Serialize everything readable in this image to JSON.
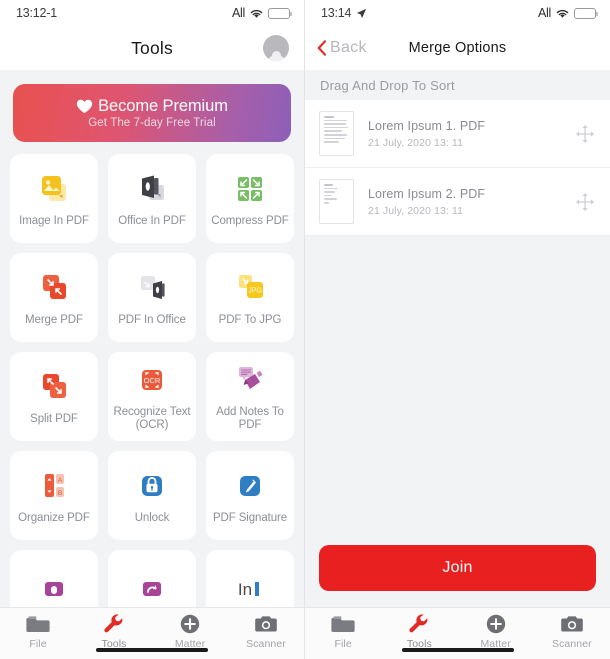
{
  "left": {
    "status": {
      "time": "13:12-1",
      "carrier": "All"
    },
    "nav": {
      "title": "Tools",
      "avatar_icon": "user-avatar-icon"
    },
    "premium": {
      "title": "Become Premium",
      "subtitle": "Get The 7-day Free Trial",
      "icon": "heart-icon"
    },
    "tools": [
      {
        "label": "Image In PDF",
        "icon": "image-to-pdf-icon",
        "color": "#f7c325"
      },
      {
        "label": "Office In PDF",
        "icon": "office-to-pdf-icon",
        "color": "#3f4045"
      },
      {
        "label": "Compress PDF",
        "icon": "compress-pdf-icon",
        "color": "#68b45a"
      },
      {
        "label": "Merge PDF",
        "icon": "merge-pdf-icon",
        "color": "#ec5b3b"
      },
      {
        "label": "PDF In Office",
        "icon": "pdf-to-office-icon",
        "color": "#3f4045"
      },
      {
        "label": "PDF To JPG",
        "icon": "pdf-to-jpg-icon",
        "color": "#f5c82a"
      },
      {
        "label": "Split PDF",
        "icon": "split-pdf-icon",
        "color": "#ec5b3b"
      },
      {
        "label": "Recognize Text (OCR)",
        "icon": "ocr-icon",
        "color": "#ed5a3a"
      },
      {
        "label": "Add Notes To PDF",
        "icon": "add-notes-icon",
        "color": "#a84f9c"
      },
      {
        "label": "Organize PDF",
        "icon": "organize-pdf-icon",
        "color": "#ec5b3b"
      },
      {
        "label": "Unlock",
        "icon": "unlock-icon",
        "color": "#2f7ec4"
      },
      {
        "label": "PDF Signature",
        "icon": "pdf-signature-icon",
        "color": "#2f7ec4"
      },
      {
        "label": "",
        "icon": "protect-pdf-icon",
        "color": "#a8439a"
      },
      {
        "label": "",
        "icon": "rotate-pdf-icon",
        "color": "#a8439a"
      },
      {
        "label": "",
        "icon": "insert-text-icon",
        "color": "#2f7ec4"
      }
    ],
    "tabs": [
      {
        "label": "File",
        "icon": "folder-icon",
        "active": false
      },
      {
        "label": "Tools",
        "icon": "wrench-icon",
        "active": true
      },
      {
        "label": "Matter",
        "icon": "plus-circle-icon",
        "active": false
      },
      {
        "label": "Scanner",
        "icon": "camera-icon",
        "active": false
      }
    ]
  },
  "right": {
    "status": {
      "time": "13:14",
      "carrier": "All",
      "location_icon": "location-arrow-icon"
    },
    "nav": {
      "back_label": "Back",
      "back_icon": "chevron-left-icon",
      "title": "Merge Options"
    },
    "section_title": "Drag And Drop To Sort",
    "documents": [
      {
        "name": "Lorem Ipsum 1. PDF",
        "date": "21 July, 2020 13: 11",
        "handle_icon": "move-handle-icon"
      },
      {
        "name": "Lorem Ipsum 2. PDF",
        "date": "21 July, 2020 13: 11",
        "handle_icon": "move-handle-icon"
      }
    ],
    "join_button": "Join",
    "tabs": [
      {
        "label": "File",
        "icon": "folder-icon",
        "active": false
      },
      {
        "label": "Tools",
        "icon": "wrench-icon",
        "active": true
      },
      {
        "label": "Matter",
        "icon": "plus-circle-icon",
        "active": false
      },
      {
        "label": "Scanner",
        "icon": "camera-icon",
        "active": false
      }
    ]
  },
  "colors": {
    "accent_red": "#e8201f",
    "tools_red": "#e02b26",
    "premium_from": "#e8514f",
    "premium_to": "#8c5fb8"
  }
}
